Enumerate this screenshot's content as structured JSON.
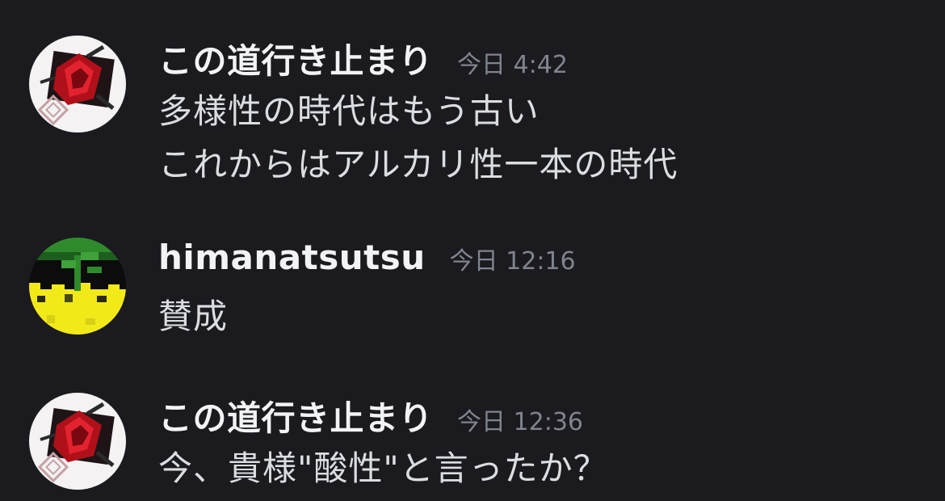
{
  "colors": {
    "background": "#1a1a1f",
    "username": "#f2f3f5",
    "message_text": "#dbdee1",
    "timestamp": "#80848e"
  },
  "messages": [
    {
      "avatar_icon": "red-cube-avatar-icon",
      "username": "この道行き止まり",
      "timestamp": "今日 4:42",
      "lines": [
        "多様性の時代はもう古い",
        "これからはアルカリ性一本の時代"
      ]
    },
    {
      "avatar_icon": "pixel-sprout-avatar-icon",
      "username": "himanatsutsu",
      "timestamp": "今日 12:16",
      "lines": [
        "賛成"
      ]
    },
    {
      "avatar_icon": "red-cube-avatar-icon",
      "username": "この道行き止まり",
      "timestamp": "今日 12:36",
      "lines": [
        "今、貴様\"酸性\"と言ったか？"
      ]
    }
  ]
}
